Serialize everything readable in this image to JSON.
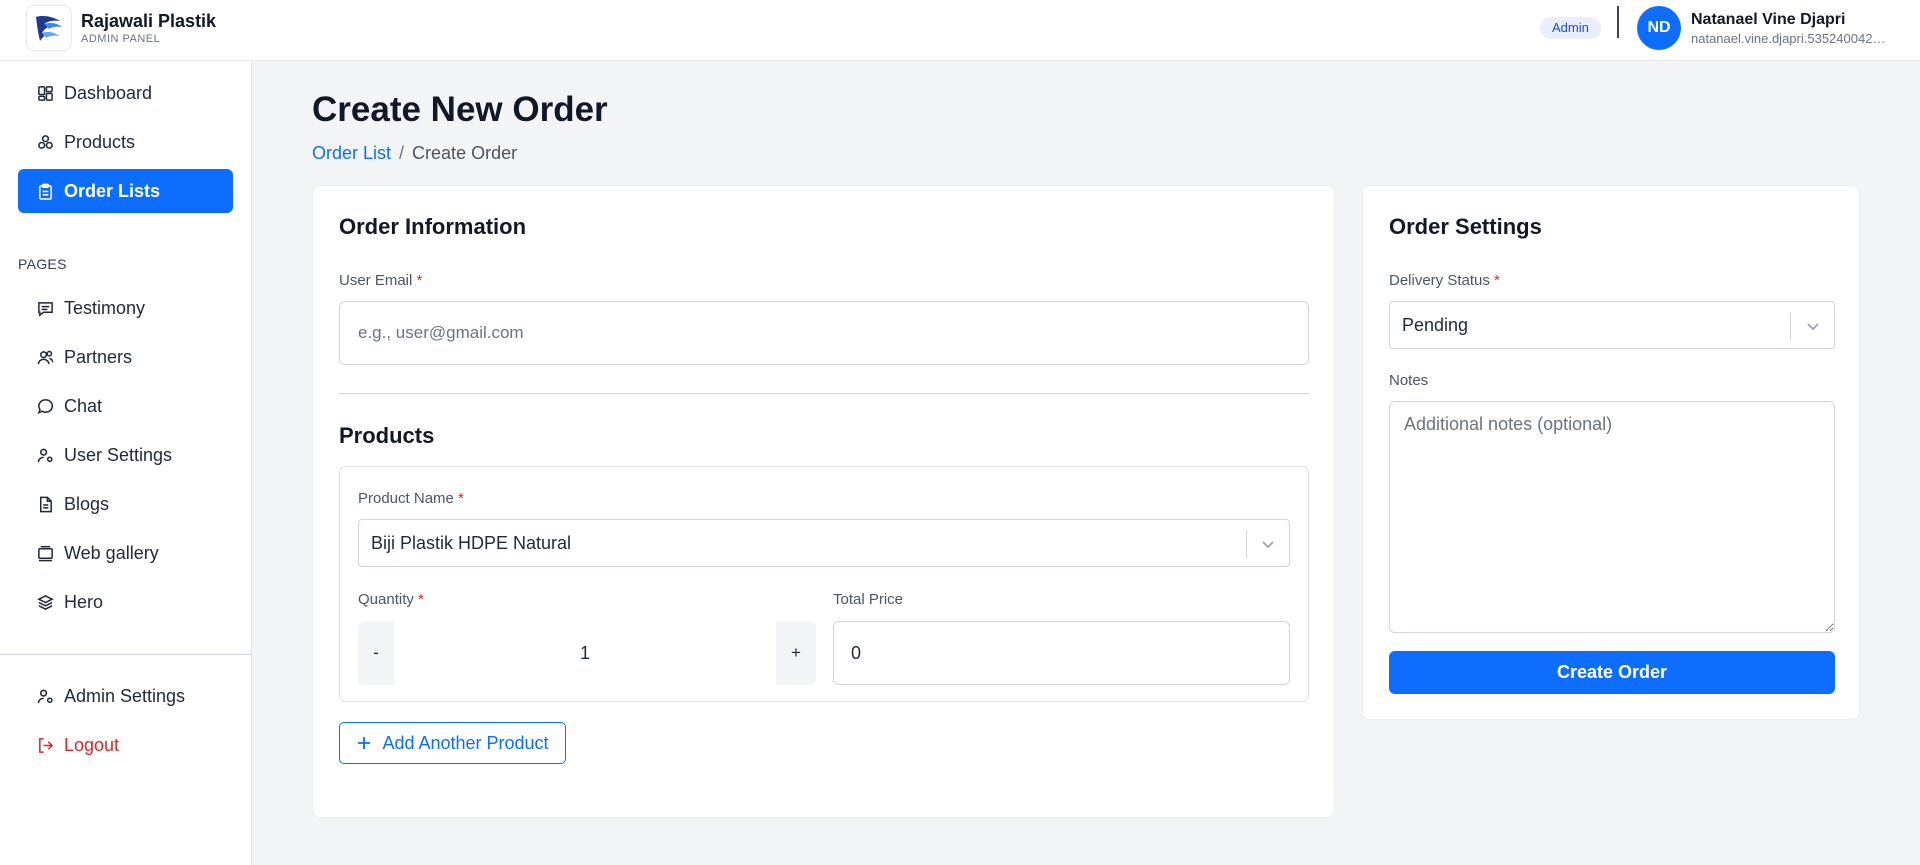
{
  "brand": {
    "name": "Rajawali Plastik",
    "subtitle": "ADMIN PANEL",
    "logo_icon": "falcon-logo-icon"
  },
  "header": {
    "role_badge": "Admin",
    "user": {
      "initials": "ND",
      "name": "Natanael Vine Djapri",
      "email": "natanael.vine.djapri.535240042@..."
    }
  },
  "sidebar": {
    "items": [
      {
        "label": "Dashboard",
        "icon": "dashboard-icon"
      },
      {
        "label": "Products",
        "icon": "products-icon"
      },
      {
        "label": "Order Lists",
        "icon": "clipboard-icon",
        "active": true
      }
    ],
    "section_label": "PAGES",
    "pages": [
      {
        "label": "Testimony",
        "icon": "message-square-icon"
      },
      {
        "label": "Partners",
        "icon": "users-icon"
      },
      {
        "label": "Chat",
        "icon": "chat-bubble-icon"
      },
      {
        "label": "User Settings",
        "icon": "user-cog-icon"
      },
      {
        "label": "Blogs",
        "icon": "document-icon"
      },
      {
        "label": "Web gallery",
        "icon": "gallery-icon"
      },
      {
        "label": "Hero",
        "icon": "layers-icon"
      }
    ],
    "bottom": [
      {
        "label": "Admin Settings",
        "icon": "user-cog-icon"
      },
      {
        "label": "Logout",
        "icon": "logout-icon"
      }
    ]
  },
  "page": {
    "title": "Create New Order",
    "breadcrumb": {
      "link": "Order List",
      "separator": "/",
      "current": "Create Order"
    }
  },
  "order_info": {
    "title": "Order Information",
    "email_label": "User Email",
    "required_mark": "*",
    "email_placeholder": "e.g., user@gmail.com",
    "email_value": ""
  },
  "products": {
    "title": "Products",
    "product_name_label": "Product Name",
    "product_selected": "Biji Plastik HDPE Natural",
    "quantity_label": "Quantity",
    "quantity_value": "1",
    "decrement": "-",
    "increment": "+",
    "total_price_label": "Total Price",
    "total_price_value": "0",
    "add_button": "Add Another Product"
  },
  "settings": {
    "title": "Order Settings",
    "delivery_label": "Delivery Status",
    "delivery_value": "Pending",
    "notes_label": "Notes",
    "notes_placeholder": "Additional notes (optional)",
    "submit": "Create Order"
  },
  "colors": {
    "primary": "#0d6efd",
    "danger": "#dc2626",
    "badge_bg": "#e8eefc"
  }
}
